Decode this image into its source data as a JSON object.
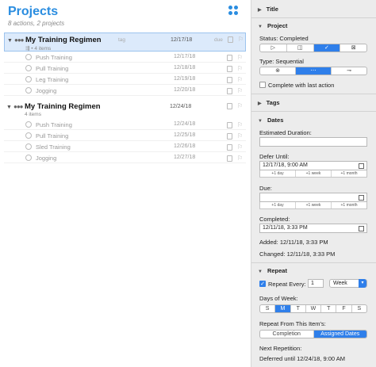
{
  "header": {
    "title": "Projects",
    "subtitle": "8 actions, 2 projects"
  },
  "projects": [
    {
      "name": "My Training Regimen",
      "meta": "⇶ • 4 items",
      "tag": "tag",
      "date": "12/17/18",
      "due": "due",
      "selected": true,
      "actions": [
        {
          "name": "Push Training",
          "date": "12/17/18"
        },
        {
          "name": "Pull Training",
          "date": "12/18/18"
        },
        {
          "name": "Leg Training",
          "date": "12/19/18"
        },
        {
          "name": "Jogging",
          "date": "12/20/18"
        }
      ]
    },
    {
      "name": "My Training Regimen",
      "meta": "4 items",
      "tag": "",
      "date": "12/24/18",
      "due": "",
      "selected": false,
      "actions": [
        {
          "name": "Push Training",
          "date": "12/24/18"
        },
        {
          "name": "Pull Training",
          "date": "12/25/18"
        },
        {
          "name": "Sled Training",
          "date": "12/26/18"
        },
        {
          "name": "Jogging",
          "date": "12/27/18"
        }
      ]
    }
  ],
  "inspector": {
    "title_section": "Title",
    "project_section": "Project",
    "status_label": "Status:  Completed",
    "status_icons": [
      "▷",
      "◫",
      "✓",
      "⊠"
    ],
    "type_label": "Type:  Sequential",
    "type_icons": [
      "⊗",
      "⋯",
      "⊸"
    ],
    "complete_with_last": "Complete with last action",
    "tags_section": "Tags",
    "dates_section": "Dates",
    "estimated_label": "Estimated Duration:",
    "estimated_value": "",
    "defer_label": "Defer Until:",
    "defer_value": "12/17/18, 9:00 AM",
    "due_label": "Due:",
    "due_value": "",
    "quick": [
      "+1 day",
      "+1 week",
      "+1 month"
    ],
    "completed_label": "Completed:",
    "completed_value": "12/11/18, 3:33 PM",
    "added": "Added:  12/11/18, 3:33 PM",
    "changed": "Changed:  12/11/18, 3:33 PM",
    "repeat_section": "Repeat",
    "repeat_every_label": "Repeat Every:",
    "repeat_every_value": "1",
    "repeat_unit": "Week",
    "days_label": "Days of Week:",
    "days": [
      "S",
      "M",
      "T",
      "W",
      "T",
      "F",
      "S"
    ],
    "repeat_from_label": "Repeat From This Item's:",
    "repeat_from_options": [
      "Completion",
      "Assigned Dates"
    ],
    "next_label": "Next Repetition:",
    "next_value": "Deferred until 12/24/18, 9:00 AM"
  },
  "colors": {
    "accent": "#2f7fea",
    "title_blue": "#2a8de0",
    "selection": "#dceafb"
  }
}
